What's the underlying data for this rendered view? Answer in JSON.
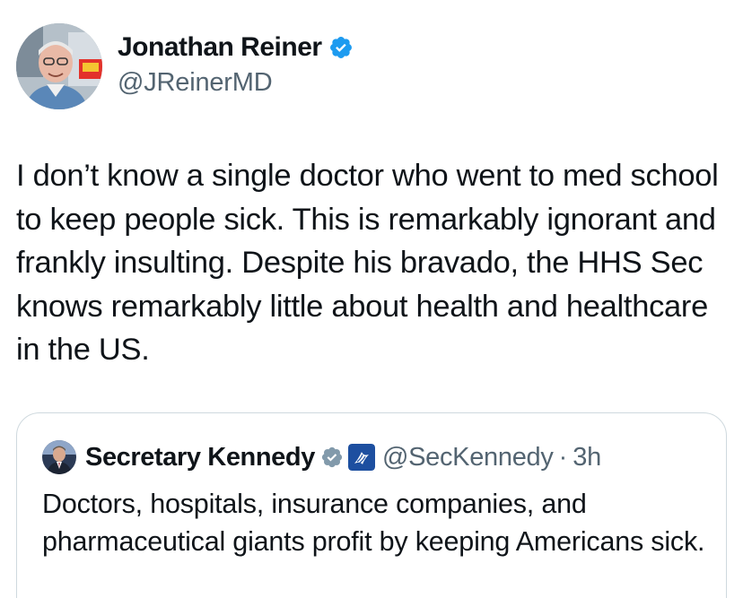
{
  "author": {
    "display_name": "Jonathan Reiner",
    "handle": "@JReinerMD",
    "verified_color": "#1d9bf0"
  },
  "tweet": {
    "text": "I don’t know a single doctor who went to med school to keep people sick. This is remarkably ignorant and frankly insulting. Despite his bravado, the HHS Sec knows remarkably little about health and healthcare in the US."
  },
  "quoted_tweet": {
    "display_name": "Secretary Kennedy",
    "handle": "@SecKennedy",
    "separator": "·",
    "time": "3h",
    "verified_color": "#829aab",
    "text": "Doctors, hospitals, insurance companies, and pharmaceutical giants profit by keeping Americans sick."
  },
  "icons": {
    "author_verified": "verified-badge-icon",
    "quote_verified": "verified-badge-icon",
    "quote_affiliation": "government-affiliation-icon"
  }
}
